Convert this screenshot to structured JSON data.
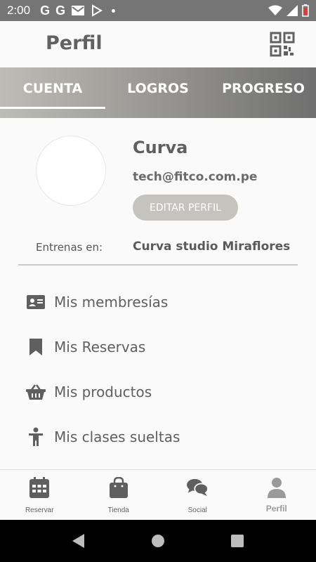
{
  "status_bar": {
    "time": "2:00",
    "notification_icons": [
      "google-icon",
      "google-icon",
      "gmail-icon",
      "play-store-icon"
    ],
    "g_label": "G"
  },
  "header": {
    "title": "Perfil",
    "action_icon": "qr-code-icon"
  },
  "tabs": [
    {
      "label": "CUENTA",
      "active": true
    },
    {
      "label": "LOGROS",
      "active": false
    },
    {
      "label": "PROGRESO",
      "active": false
    }
  ],
  "profile": {
    "name": "Curva",
    "email": "tech@fitco.com.pe",
    "edit_label": "EDITAR PERFIL",
    "train_label": "Entrenas en:",
    "train_value": "Curva studio Miraflores"
  },
  "menu": [
    {
      "label": "Mis membresías",
      "icon": "id-card-icon"
    },
    {
      "label": "Mis Reservas",
      "icon": "bookmark-icon"
    },
    {
      "label": "Mis productos",
      "icon": "basket-icon"
    },
    {
      "label": "Mis clases sueltas",
      "icon": "person-icon"
    }
  ],
  "bottom_nav": [
    {
      "label": "Reservar",
      "icon": "calendar-icon",
      "active": false
    },
    {
      "label": "Tienda",
      "icon": "shopping-bag-icon",
      "active": false
    },
    {
      "label": "Social",
      "icon": "chat-icon",
      "active": false
    },
    {
      "label": "Perfil",
      "icon": "user-icon",
      "active": true
    }
  ],
  "colors": {
    "status_bar": "#757575",
    "tab_gradient_start": "#bdbcb6",
    "tab_gradient_end": "#6f6f6f",
    "edit_button": "#c4c3be",
    "icon": "#5f5f5f"
  }
}
